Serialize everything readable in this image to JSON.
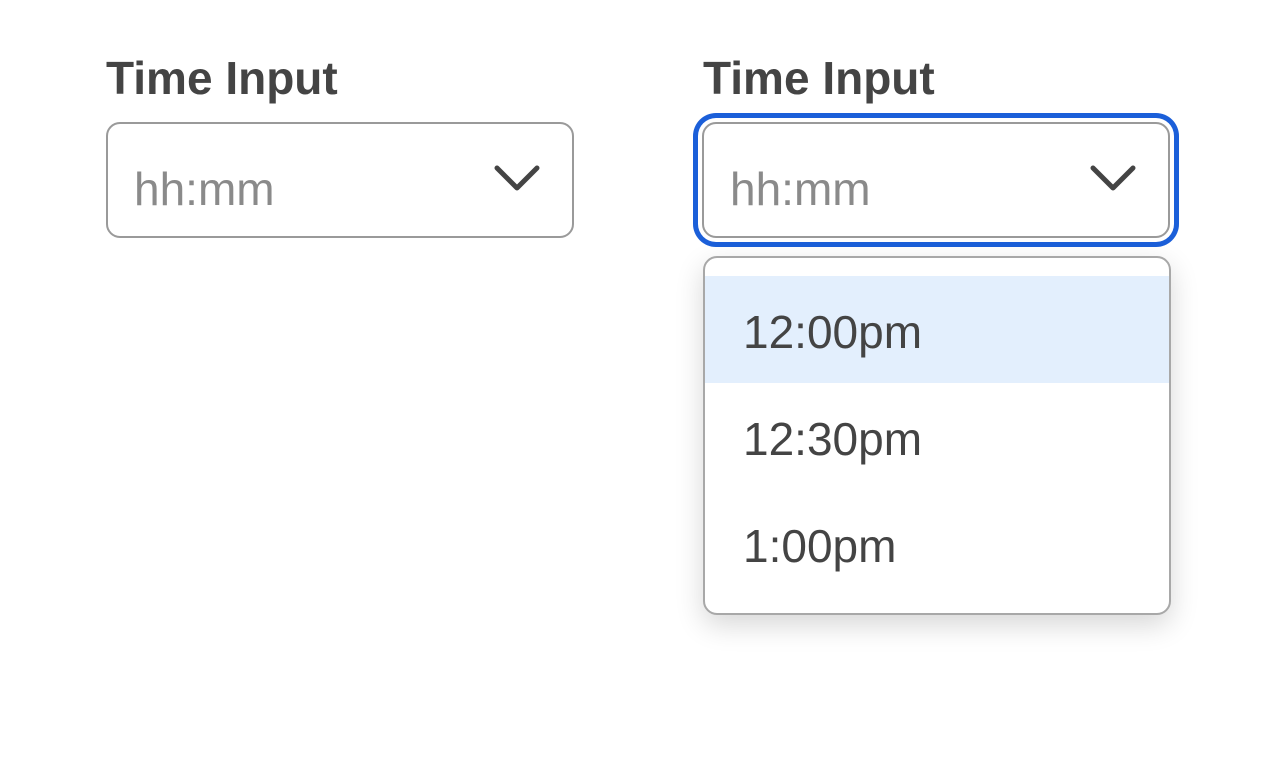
{
  "time_inputs": [
    {
      "label": "Time Input",
      "placeholder": "hh:mm",
      "focused": false,
      "expanded": false
    },
    {
      "label": "Time Input",
      "placeholder": "hh:mm",
      "focused": true,
      "expanded": true,
      "options": [
        "12:00pm",
        "12:30pm",
        "1:00pm"
      ],
      "highlighted_option": "12:00pm"
    }
  ],
  "icons": {
    "dropdown_toggle": "chevron-down-icon"
  },
  "colors": {
    "focus_ring": "#1b5fd9",
    "highlight_background": "#e3effd",
    "label_text": "#444444",
    "placeholder_text": "#8a8a8a",
    "border": "#9a9a9a"
  }
}
